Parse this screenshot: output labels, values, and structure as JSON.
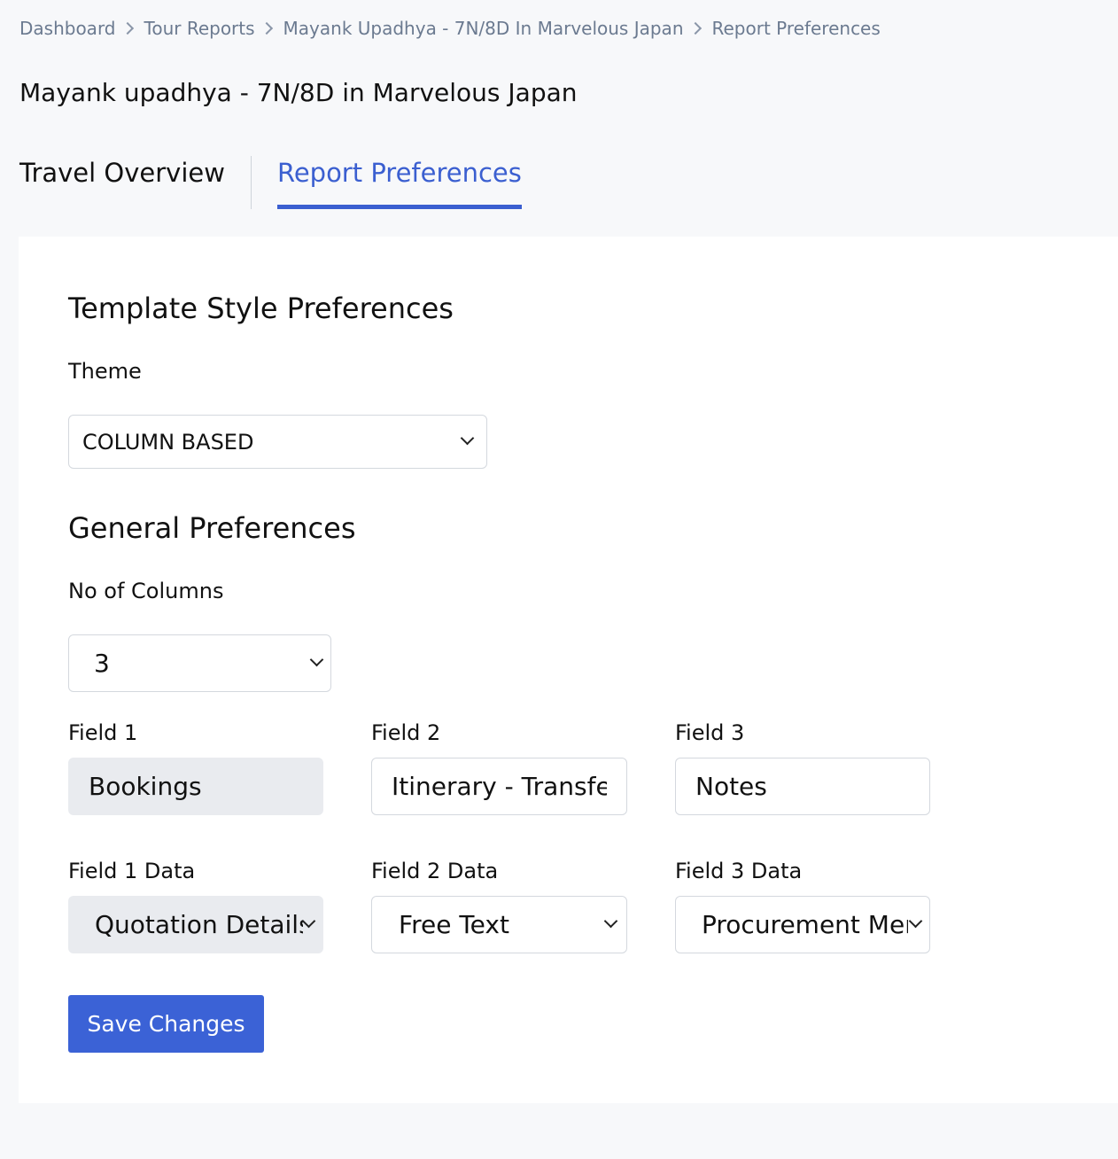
{
  "breadcrumb": {
    "items": [
      "Dashboard",
      "Tour Reports",
      "Mayank Upadhya - 7N/8D In Marvelous Japan",
      "Report Preferences"
    ]
  },
  "page": {
    "title": "Mayank upadhya - 7N/8D in Marvelous Japan"
  },
  "tabs": [
    {
      "label": "Travel Overview",
      "active": false
    },
    {
      "label": "Report Preferences",
      "active": true
    }
  ],
  "template_style": {
    "heading": "Template Style Preferences",
    "theme_label": "Theme",
    "theme_value": "COLUMN BASED"
  },
  "general": {
    "heading": "General Preferences",
    "columns_label": "No of Columns",
    "columns_value": "3",
    "fields": [
      {
        "label": "Field 1",
        "value": "Bookings",
        "disabled": true
      },
      {
        "label": "Field 2",
        "value": "Itinerary - Transfer",
        "disabled": false
      },
      {
        "label": "Field 3",
        "value": "Notes",
        "disabled": false
      }
    ],
    "field_data": [
      {
        "label": "Field 1 Data",
        "value": "Quotation Details",
        "disabled": true
      },
      {
        "label": "Field 2 Data",
        "value": "Free Text",
        "disabled": false
      },
      {
        "label": "Field 3 Data",
        "value": "Procurement Men",
        "disabled": false
      }
    ]
  },
  "actions": {
    "save_label": "Save Changes"
  },
  "colors": {
    "accent": "#3b5fd0",
    "button": "#3b62d6",
    "disabled_field": "#e9ebef",
    "breadcrumb_text": "#6b7a90"
  }
}
